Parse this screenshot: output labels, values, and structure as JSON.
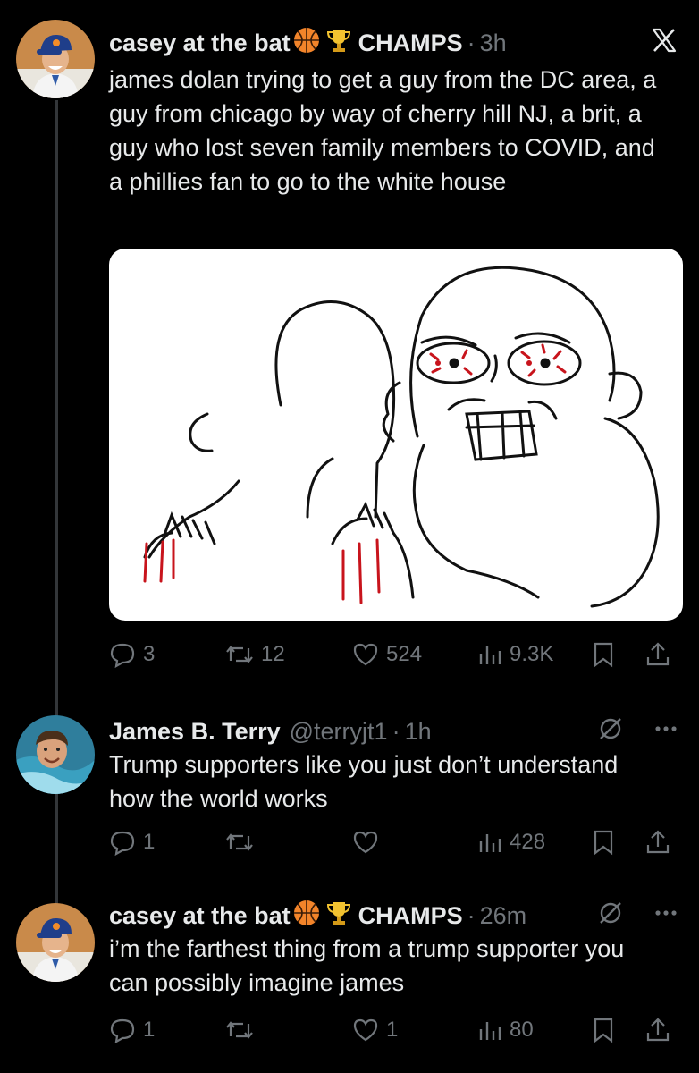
{
  "tweets": [
    {
      "name": "casey at the bat",
      "badge": "CHAMPS",
      "time": "3h",
      "text": "james dolan trying to get a guy from the DC area, a guy from chicago by way of cherry hill NJ, a brit, a guy who lost seven family members to COVID, and a phillies fan to go to the white house",
      "replies": "3",
      "reposts": "12",
      "likes": "524",
      "views": "9.3K"
    },
    {
      "name": "James B. Terry",
      "handle": "@terryjt1",
      "time": "1h",
      "text": "Trump supporters like you just don’t understand how the world works",
      "replies": "1",
      "reposts": "",
      "likes": "",
      "views": "428"
    },
    {
      "name": "casey at the bat",
      "badge": "CHAMPS",
      "time": "26m",
      "text": "i’m the farthest thing from a trump supporter you can possibly imagine james",
      "replies": "1",
      "reposts": "",
      "likes": "1",
      "views": "80"
    }
  ],
  "icons": {
    "close": "x-logo-icon",
    "reply": "reply-icon",
    "repost": "repost-icon",
    "like": "heart-icon",
    "views": "views-icon",
    "bookmark": "bookmark-icon",
    "share": "share-icon",
    "more": "more-icon",
    "mute": "mute-icon"
  },
  "colors": {
    "background": "#000000",
    "text": "#e7e9ea",
    "muted": "#71767b",
    "divider": "#333639"
  }
}
